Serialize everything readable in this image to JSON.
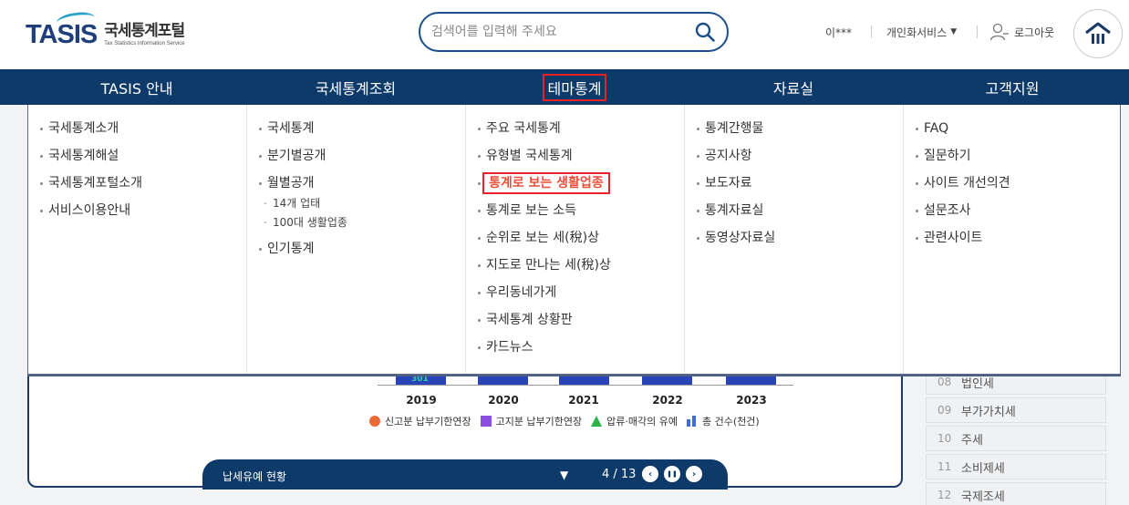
{
  "header": {
    "logo_mark": "TASIS",
    "logo_kr": "국세통계포털",
    "logo_en": "Tax Statistics Information Service",
    "search_placeholder": "검색어를 입력해 주세요",
    "search_icon": "search-icon",
    "user_name": "이***",
    "personal_service": "개인화서비스",
    "personal_service_caret": "▼",
    "logout": "로그아웃",
    "home_icon": "home-icon"
  },
  "gnb": [
    {
      "label": "TASIS 안내"
    },
    {
      "label": "국세통계조회"
    },
    {
      "label": "테마통계",
      "active": true
    },
    {
      "label": "자료실"
    },
    {
      "label": "고객지원"
    }
  ],
  "mega": {
    "col1": [
      "국세통계소개",
      "국세통계해설",
      "국세통계포털소개",
      "서비스이용안내"
    ],
    "col2": {
      "items": [
        "국세통계",
        "분기별공개",
        "월별공개"
      ],
      "sub": [
        "14개 업태",
        "100대 생활업종"
      ],
      "after": [
        "인기통계"
      ]
    },
    "col3": [
      "주요 국세통계",
      "유형별 국세통계",
      "통계로 보는 생활업종",
      "통계로 보는 소득",
      "순위로 보는 세(稅)상",
      "지도로 만나는 세(稅)상",
      "우리동네가게",
      "국세통계 상황판",
      "카드뉴스"
    ],
    "col4": [
      "통계간행물",
      "공지사항",
      "보도자료",
      "통계자료실",
      "동영상자료실"
    ],
    "col5": [
      "FAQ",
      "질문하기",
      "사이트 개선의견",
      "설문조사",
      "관련사이트"
    ]
  },
  "chart_data": {
    "type": "bar",
    "categories": [
      "2019",
      "2020",
      "2021",
      "2022",
      "2023"
    ],
    "visible_data_label": "301",
    "legend": [
      "신고분 납부기한연장",
      "고지분 납부기한연장",
      "압류·매각의 유예",
      "총 건수(천건)"
    ],
    "colors": {
      "series1": "#ec6a36",
      "series2": "#8a4fe0",
      "series3": "#2bb44a",
      "series4": "#3d6fd6",
      "bars": "#2944b6"
    }
  },
  "footer_bar": {
    "title": "납세유예 현황",
    "dropdown_caret": "▼",
    "page": "4 / 13",
    "prev": "‹",
    "pause": "❚❚",
    "next": "›"
  },
  "side_list": [
    {
      "num": "08",
      "label": "법인세"
    },
    {
      "num": "09",
      "label": "부가가치세"
    },
    {
      "num": "10",
      "label": "주세"
    },
    {
      "num": "11",
      "label": "소비제세"
    },
    {
      "num": "12",
      "label": "국제조세"
    }
  ]
}
